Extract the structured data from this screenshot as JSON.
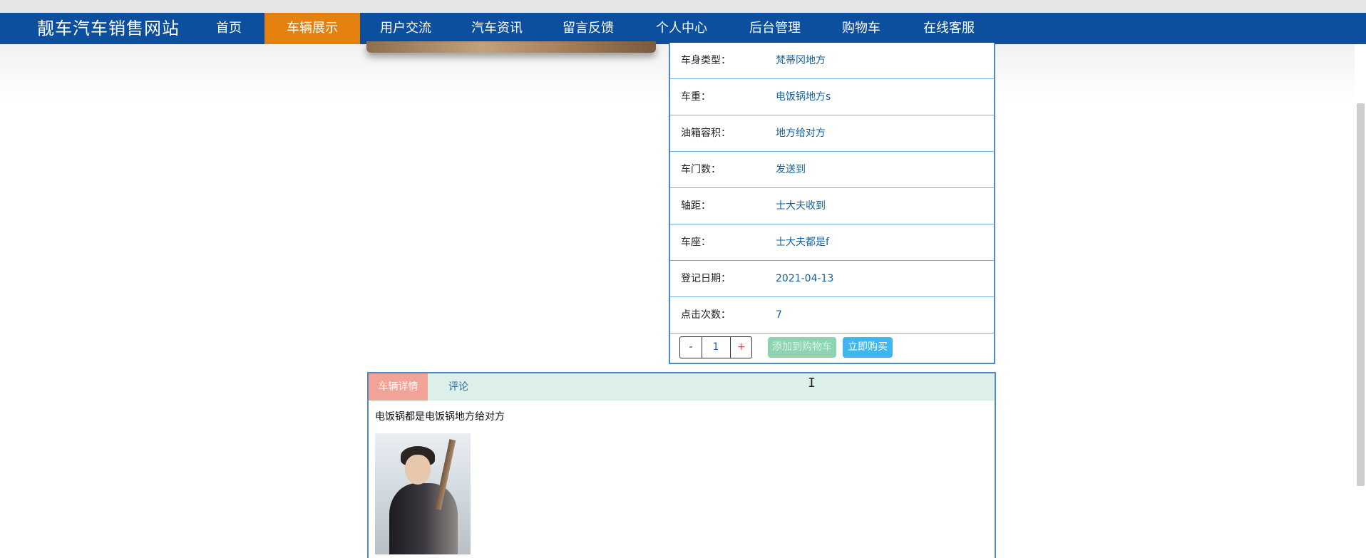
{
  "header": {
    "brand": "靓车汽车销售网站",
    "nav": [
      {
        "label": "首页",
        "active": false
      },
      {
        "label": "车辆展示",
        "active": true
      },
      {
        "label": "用户交流",
        "active": false
      },
      {
        "label": "汽车资讯",
        "active": false
      },
      {
        "label": "留言反馈",
        "active": false
      },
      {
        "label": "个人中心",
        "active": false
      },
      {
        "label": "后台管理",
        "active": false
      },
      {
        "label": "购物车",
        "active": false
      },
      {
        "label": "在线客服",
        "active": false
      }
    ]
  },
  "info": {
    "rows": [
      {
        "label": "车身类型：",
        "value": "梵蒂冈地方"
      },
      {
        "label": "车重：",
        "value": "电饭锅地方s"
      },
      {
        "label": "油箱容积：",
        "value": "地方给对方"
      },
      {
        "label": "车门数：",
        "value": "发送到"
      },
      {
        "label": "轴距：",
        "value": "士大夫收到"
      },
      {
        "label": "车座：",
        "value": "士大夫都是f"
      },
      {
        "label": "登记日期：",
        "value": "2021-04-13"
      },
      {
        "label": "点击次数：",
        "value": "7"
      }
    ]
  },
  "purchase": {
    "minus": "-",
    "quantity": "1",
    "plus": "+",
    "add_to_cart": "添加到购物车",
    "buy_now": "立即购买"
  },
  "detail": {
    "tabs": [
      "车辆详情",
      "评论"
    ],
    "active_tab": "车辆详情",
    "text": "电饭锅都是电饭锅地方给对方"
  },
  "colors": {
    "navbar": "#0b4f9e",
    "nav_active": "#e4810f",
    "panel_border": "#4a8ac9",
    "row_divider": "#6fb3e3",
    "add_to_cart_bg": "#8fd3b0",
    "buy_now_bg": "#3fb6ee",
    "tab_active_bg": "#f1a397",
    "tab_bar_bg": "#dcefe8"
  }
}
